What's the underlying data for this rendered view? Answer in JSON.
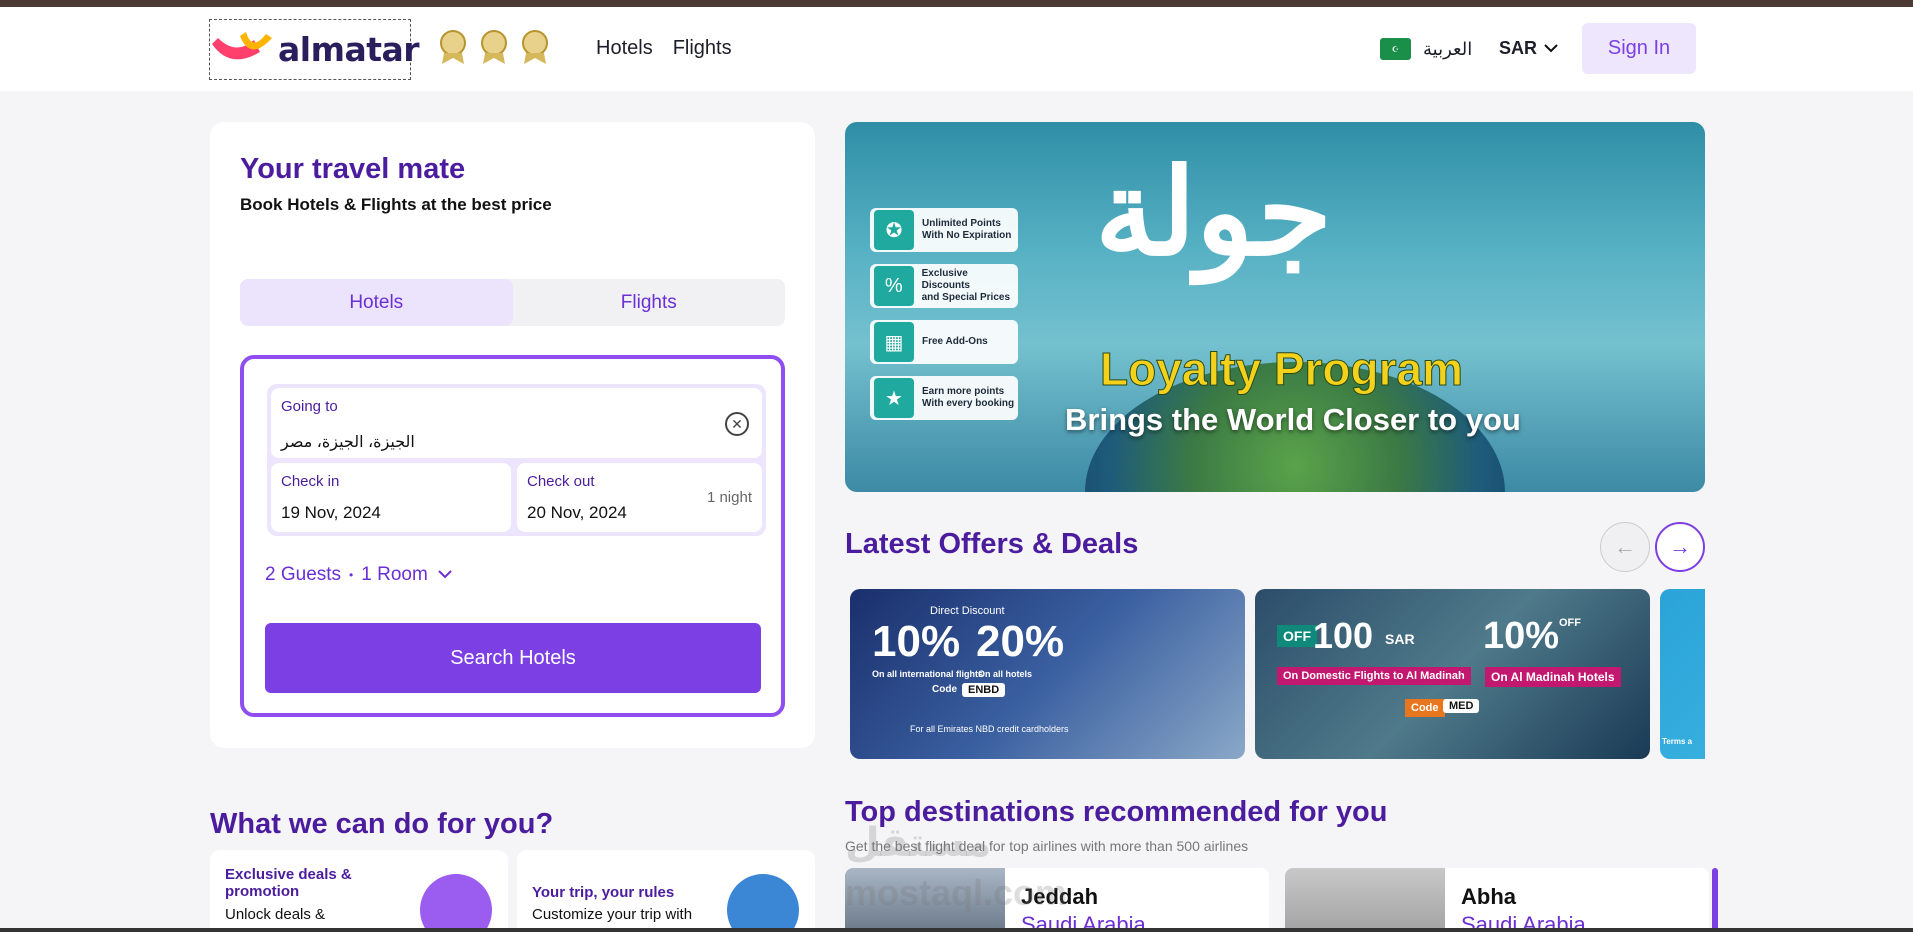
{
  "header": {
    "logo_text": "almatar",
    "nav": [
      "Hotels",
      "Flights"
    ],
    "lang_label": "العربية",
    "currency": "SAR",
    "signin_label": "Sign In"
  },
  "booking": {
    "title": "Your travel mate",
    "subtitle": "Book Hotels & Flights at the best price",
    "tabs": [
      "Hotels",
      "Flights"
    ],
    "going_to_label": "Going to",
    "going_to_value": "الجيزة، الجيزة، مصر",
    "check_in_label": "Check in",
    "check_in_value": "19 Nov, 2024",
    "check_out_label": "Check out",
    "check_out_value": "20 Nov, 2024",
    "nights": "1 night",
    "guests": "2 Guests",
    "rooms": "1 Room",
    "search_button": "Search Hotels"
  },
  "banner": {
    "badges": [
      {
        "line1": "Unlimited Points",
        "line2": "With No Expiration"
      },
      {
        "line1": "Exclusive Discounts",
        "line2": "and Special Prices"
      },
      {
        "line1": "Free Add-Ons",
        "line2": ""
      },
      {
        "line1": "Earn more points",
        "line2": "With every booking"
      }
    ],
    "arabic": "جولة",
    "title": "Loyalty Program",
    "subtitle": "Brings the World Closer to you"
  },
  "offers": {
    "title": "Latest Offers & Deals",
    "offer1": {
      "heading": "Direct Discount",
      "pct1": "10%",
      "pct1_sub": "On all international flights",
      "pct2": "20%",
      "pct2_sub": "On all hotels",
      "code_label": "Code",
      "code": "ENBD",
      "note": "For all Emirates NBD credit cardholders"
    },
    "offer2": {
      "off": "OFF",
      "amount": "100",
      "currency": "SAR",
      "left_sub": "On Domestic Flights to Al Madinah",
      "pct": "10%",
      "pct_off": "OFF",
      "right_sub": "On Al Madinah Hotels",
      "code_label": "Code",
      "code": "MED"
    },
    "offer3_text": "Terms a"
  },
  "services": {
    "title": "What we can do for you?",
    "cards": [
      {
        "title": "Exclusive deals & promotion",
        "desc": "Unlock deals &"
      },
      {
        "title": "Your trip, your rules",
        "desc": "Customize your trip with"
      }
    ]
  },
  "destinations": {
    "title": "Top destinations recommended for you",
    "subtitle": "Get the best flight deal for top airlines with more than 500 airlines",
    "items": [
      {
        "city": "Jeddah",
        "country": "Saudi Arabia"
      },
      {
        "city": "Abha",
        "country": "Saudi Arabia"
      }
    ]
  },
  "watermark": {
    "arabic": "مستقل",
    "latin": "mostaql.com"
  },
  "colors": {
    "accent": "#7b3fe4",
    "heading": "#4b1d9e",
    "tab_active_bg": "#ece4fd"
  }
}
